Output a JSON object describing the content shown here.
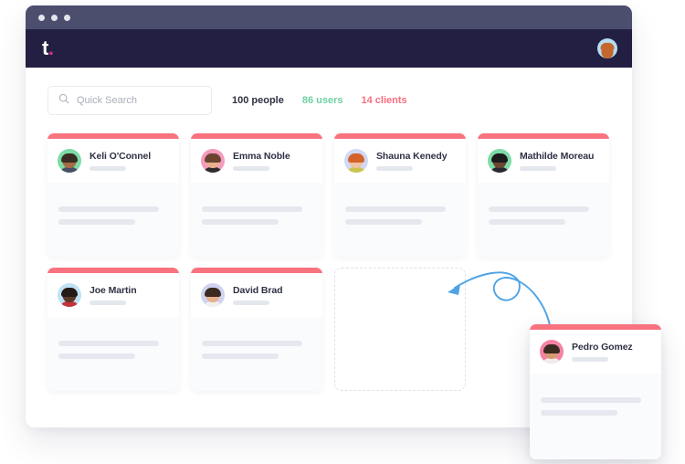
{
  "window": {
    "chrome_dots": 3,
    "logo_text": "t",
    "logo_dot": ".",
    "avatar_name": "header-user-avatar"
  },
  "colors": {
    "chrome_bar": "#4b4e6d",
    "app_header": "#231f43",
    "card_accent": "#f8737f",
    "logo_dot": "#e82a8e",
    "stat_users": "#6fd0a2",
    "stat_clients": "#fa6d7e",
    "arrow": "#4ea3e4"
  },
  "search": {
    "placeholder": "Quick Search",
    "value": "",
    "icon": "search-icon"
  },
  "stats": {
    "people": "100 people",
    "users": "86 users",
    "clients": "14 clients"
  },
  "cards": [
    {
      "name": "Keli O'Connel",
      "avatar_bg": "#7ddba6",
      "skin": "#a56b43",
      "hair": "#3a2c23",
      "body": "#4a4f63"
    },
    {
      "name": "Emma Noble",
      "avatar_bg": "#f59bbd",
      "skin": "#e9b08f",
      "hair": "#6b4430",
      "body": "#2e2b2e"
    },
    {
      "name": "Shauna Kenedy",
      "avatar_bg": "#cfd9f5",
      "skin": "#f0c3a3",
      "hair": "#d4622c",
      "body": "#c9c44e"
    },
    {
      "name": "Mathilde Moreau",
      "avatar_bg": "#7ddba6",
      "skin": "#6a4630",
      "hair": "#1d1a1c",
      "body": "#2b2730"
    },
    {
      "name": "Joe Martin",
      "avatar_bg": "#bfe2f5",
      "skin": "#5a3a28",
      "hair": "#241a16",
      "body": "#c4333a"
    },
    {
      "name": "David Brad",
      "avatar_bg": "#cfd2f0",
      "skin": "#e5b08c",
      "hair": "#3b2a20",
      "body": "#f2f0ee"
    }
  ],
  "placeholder_slot": {
    "label": "empty-drop-slot"
  },
  "drag_card": {
    "name": "Pedro Gomez",
    "avatar_bg": "#f582a4",
    "skin": "#d49b72",
    "hair": "#3a2a20",
    "body": "#efeceb"
  }
}
